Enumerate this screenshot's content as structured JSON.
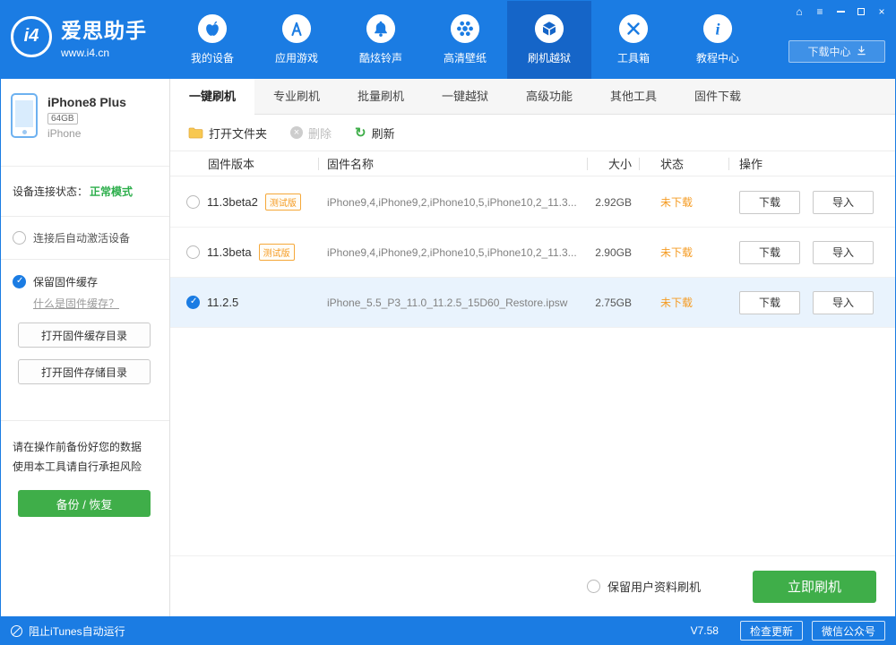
{
  "colors": {
    "header_blue": "#1b7ce3",
    "active_nav_blue": "#1565c8",
    "action_green": "#3fae49",
    "status_orange": "#f59b22",
    "connection_green": "#2cae4b",
    "selected_row_blue": "#e9f3fd"
  },
  "header": {
    "logo": {
      "mark": "i4",
      "title": "爱思助手",
      "url": "www.i4.cn"
    },
    "nav": [
      {
        "label": "我的设备",
        "icon": "apple-icon"
      },
      {
        "label": "应用游戏",
        "icon": "appstore-icon"
      },
      {
        "label": "酷炫铃声",
        "icon": "bell-icon"
      },
      {
        "label": "高清壁纸",
        "icon": "flower-icon"
      },
      {
        "label": "刷机越狱",
        "icon": "package-box-icon"
      },
      {
        "label": "工具箱",
        "icon": "crossed-tools-icon"
      },
      {
        "label": "教程中心",
        "icon": "info-icon"
      }
    ],
    "active_nav_index": 4,
    "download_center_label": "下载中心",
    "window_controls": [
      "home",
      "menu",
      "minimize",
      "maximize",
      "close"
    ]
  },
  "sidebar": {
    "device": {
      "name": "iPhone8 Plus",
      "capacity": "64GB",
      "type": "iPhone"
    },
    "connection": {
      "label": "设备连接状态：",
      "value": "正常模式"
    },
    "auto_activate_label": "连接后自动激活设备",
    "keep_cache_label": "保留固件缓存",
    "cache_help_link": "什么是固件缓存？",
    "open_cache_dir_button": "打开固件缓存目录",
    "open_storage_dir_button": "打开固件存储目录",
    "warning_line1": "请在操作前备份好您的数据",
    "warning_line2": "使用本工具请自行承担风险",
    "backup_restore_button": "备份 / 恢复"
  },
  "tabs": [
    {
      "label": "一键刷机",
      "active": true
    },
    {
      "label": "专业刷机",
      "active": false
    },
    {
      "label": "批量刷机",
      "active": false
    },
    {
      "label": "一键越狱",
      "active": false
    },
    {
      "label": "高级功能",
      "active": false
    },
    {
      "label": "其他工具",
      "active": false
    },
    {
      "label": "固件下载",
      "active": false
    }
  ],
  "toolbar": {
    "open_folder_label": "打开文件夹",
    "delete_label": "删除",
    "refresh_label": "刷新"
  },
  "firmware_table": {
    "headers": {
      "version": "固件版本",
      "name": "固件名称",
      "size": "大小",
      "status": "状态",
      "action": "操作"
    },
    "download_button": "下载",
    "import_button": "导入",
    "rows": [
      {
        "version": "11.3beta2",
        "badge": "测试版",
        "name": "iPhone9,4,iPhone9,2,iPhone10,5,iPhone10,2_11.3...",
        "size": "2.92GB",
        "status": "未下载",
        "selected": false
      },
      {
        "version": "11.3beta",
        "badge": "测试版",
        "name": "iPhone9,4,iPhone9,2,iPhone10,5,iPhone10,2_11.3...",
        "size": "2.90GB",
        "status": "未下载",
        "selected": false
      },
      {
        "version": "11.2.5",
        "badge": "",
        "name": "iPhone_5.5_P3_11.0_11.2.5_15D60_Restore.ipsw",
        "size": "2.75GB",
        "status": "未下载",
        "selected": true
      }
    ]
  },
  "action_bar": {
    "keep_user_data_label": "保留用户资料刷机",
    "flash_now_button": "立即刷机"
  },
  "statusbar": {
    "block_itunes_label": "阻止iTunes自动运行",
    "version": "V7.58",
    "check_update_button": "检查更新",
    "wechat_button": "微信公众号"
  }
}
